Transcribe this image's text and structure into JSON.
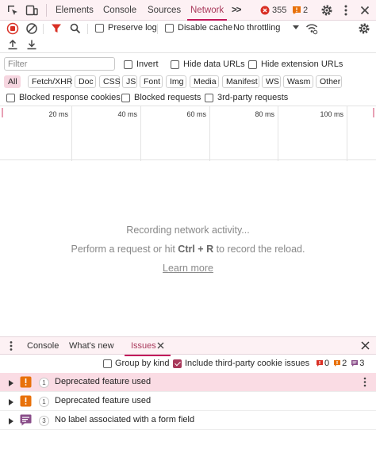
{
  "top_tabs": {
    "elements": "Elements",
    "console": "Console",
    "sources": "Sources",
    "network": "Network",
    "more": ">>"
  },
  "top_counts": {
    "errors": "355",
    "warnings": "2"
  },
  "toolbar": {
    "preserve_log": "Preserve log",
    "disable_cache": "Disable cache",
    "throttling": "No throttling"
  },
  "filter": {
    "placeholder": "Filter",
    "invert": "Invert",
    "hide_data_urls": "Hide data URLs",
    "hide_extension_urls": "Hide extension URLs"
  },
  "type_filters": [
    "All",
    "Fetch/XHR",
    "Doc",
    "CSS",
    "JS",
    "Font",
    "Img",
    "Media",
    "Manifest",
    "WS",
    "Wasm",
    "Other"
  ],
  "blocked": {
    "response_cookies": "Blocked response cookies",
    "requests": "Blocked requests",
    "third_party": "3rd-party requests"
  },
  "timeline_ticks": [
    "20 ms",
    "40 ms",
    "60 ms",
    "80 ms",
    "100 ms"
  ],
  "empty": {
    "line1": "Recording network activity...",
    "line2_pre": "Perform a request or hit ",
    "line2_key": "Ctrl + R",
    "line2_post": " to record the reload.",
    "learn_more": "Learn more"
  },
  "drawer": {
    "tabs": {
      "console": "Console",
      "whats_new": "What's new",
      "issues": "Issues"
    },
    "group_by_kind": "Group by kind",
    "include_third_party": "Include third-party cookie issues",
    "counts": {
      "errors": "0",
      "warnings": "2",
      "info": "3"
    },
    "issues": [
      {
        "count": "1",
        "label": "Deprecated feature used",
        "kind": "warning"
      },
      {
        "count": "1",
        "label": "Deprecated feature used",
        "kind": "warning"
      },
      {
        "count": "3",
        "label": "No label associated with a form field",
        "kind": "info"
      }
    ]
  },
  "colors": {
    "accent": "#c2185b",
    "tab_bar": "#fdf1f4",
    "warning": "#e8710a",
    "info": "#8a4e8a",
    "error": "#d93025"
  }
}
